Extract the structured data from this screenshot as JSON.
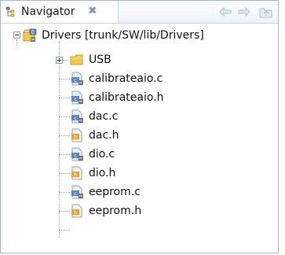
{
  "view": {
    "title": "Navigator",
    "close_glyph": "✖"
  },
  "toolbar": {
    "back_icon": "back-arrow-icon",
    "forward_icon": "forward-arrow-icon",
    "up_icon": "up-folder-icon"
  },
  "tree": {
    "root": {
      "label": "Drivers [trunk/SW/lib/Drivers]",
      "expanded": true,
      "icon": "svn-project-icon"
    },
    "items": [
      {
        "label": "USB",
        "type": "folder",
        "expanded": false,
        "icon": "folder-icon"
      },
      {
        "label": "calibrateaio.c",
        "type": "c-source",
        "icon": "c-source-file-icon"
      },
      {
        "label": "calibrateaio.h",
        "type": "c-source",
        "icon": "c-source-file-icon"
      },
      {
        "label": "dac.c",
        "type": "c-source",
        "icon": "c-source-file-icon"
      },
      {
        "label": "dac.h",
        "type": "c-header",
        "icon": "c-header-file-icon"
      },
      {
        "label": "dio.c",
        "type": "c-source",
        "icon": "c-source-file-icon"
      },
      {
        "label": "dio.h",
        "type": "c-header",
        "icon": "c-header-file-icon"
      },
      {
        "label": "eeprom.c",
        "type": "c-source",
        "icon": "c-source-file-icon"
      },
      {
        "label": "eeprom.h",
        "type": "c-header",
        "icon": "c-header-file-icon"
      }
    ]
  },
  "colors": {
    "frame_border": "#a9b6c8",
    "folder_yellow": "#f2c94c",
    "header_orange": "#e8a23a",
    "source_blue": "#5a86c2"
  }
}
